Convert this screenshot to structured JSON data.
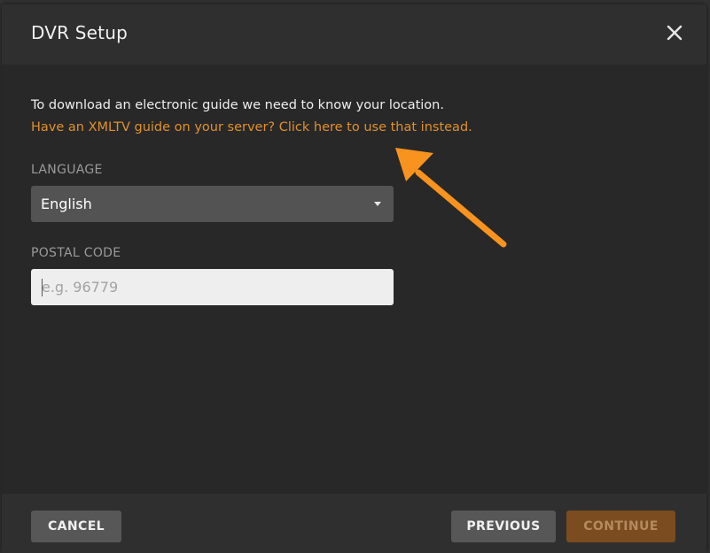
{
  "dialog": {
    "title": "DVR Setup",
    "close_icon": "close-icon"
  },
  "intro": {
    "text": "To download an electronic guide we need to know your location.",
    "xmltv_link": "Have an XMLTV guide on your server? Click here to use that instead."
  },
  "language": {
    "label": "LANGUAGE",
    "selected": "English",
    "caret_icon": "caret-down-icon"
  },
  "postal": {
    "label": "POSTAL CODE",
    "value": "",
    "placeholder": "e.g. 96779"
  },
  "footer": {
    "cancel_label": "CANCEL",
    "previous_label": "PREVIOUS",
    "continue_label": "CONTINUE"
  },
  "annotation": {
    "arrow_icon": "arrow-pointer-icon",
    "arrow_color": "#f7931e"
  },
  "colors": {
    "accent": "#e0902a",
    "modal_bg": "#282828",
    "header_bg": "#2f2f2f",
    "button_bg": "#575757",
    "continue_bg": "#7a4c1f"
  }
}
